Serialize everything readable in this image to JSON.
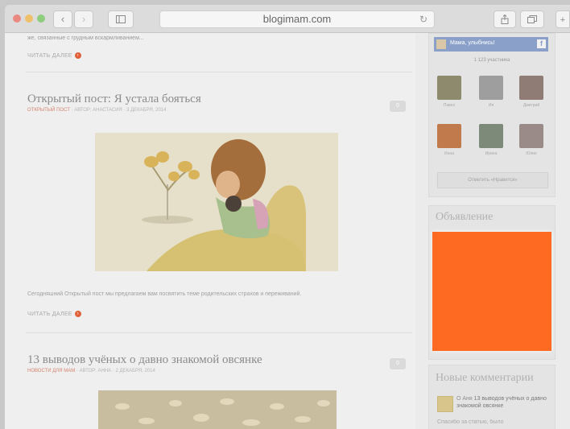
{
  "browser": {
    "url": "blogimam.com",
    "back_icon": "‹",
    "forward_icon": "›",
    "reload_icon": "↻"
  },
  "main": {
    "prev_excerpt_tail": "же, связанные с грудным вскармливанием...",
    "read_more_label": "ЧИТАТЬ ДАЛЕЕ",
    "posts": [
      {
        "title": "Открытый пост: Я устала бояться",
        "category": "ОТКРЫТЫЙ ПОСТ",
        "meta": "АВТОР: АНАСТАСИЯ  ·  3 ДЕКАБРЯ, 2014",
        "comments": "0",
        "excerpt": "Сегодняшний Открытый пост мы предлагаем вам посвятить теме родительских страхов и переживаний."
      },
      {
        "title": "13 выводов учёных о давно знакомой овсянке",
        "category": "НОВОСТИ ДЛЯ МАМ",
        "meta": "АВТОР: АННА  ·  2 ДЕКАБРЯ, 2014",
        "comments": "0"
      }
    ]
  },
  "sidebar": {
    "fb_page_name": "Мама, улыбнись!",
    "fb_count": "1 123 участника",
    "fb_follow_label": "Отметить «Нравится»",
    "members": [
      {
        "name": "Павел"
      },
      {
        "name": "Ия"
      },
      {
        "name": "Дмитрий"
      },
      {
        "name": "Инна"
      },
      {
        "name": "Ирина"
      },
      {
        "name": "Юлия"
      }
    ],
    "ads_title": "Объявление",
    "ad_color": "#ff6a22",
    "new_comments_title": "Новые комментарии",
    "comment_line1": "О Аня",
    "comment_line2": "13 выводов учёных о давно знакомой овсянке",
    "comment_line3": "Спасибо за статью, было"
  },
  "colors": {
    "accent_red": "#e0613a",
    "ad_orange": "#ff6a22",
    "fb_blue": "#8aa0c8"
  }
}
